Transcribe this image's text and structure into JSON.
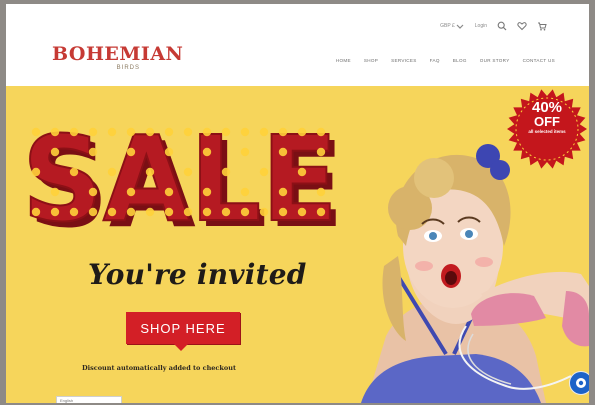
{
  "header": {
    "utility": {
      "currency": "GBP £",
      "login": "Login"
    },
    "logo": {
      "main": "BOHEMIAN",
      "sub": "BIRDS"
    },
    "nav": [
      "HOME",
      "SHOP",
      "SERVICES",
      "FAQ",
      "BLOG",
      "OUR STORY",
      "CONTACT US"
    ]
  },
  "hero": {
    "sale": "SALE",
    "invite": "You're invited",
    "cta": "SHOP HERE",
    "discount_note": "Discount automatically added to checkout",
    "badge": {
      "percent": "40%",
      "off": "OFF",
      "sub": "all selected items"
    }
  },
  "footer": {
    "language": "English"
  },
  "colors": {
    "hero_bg": "#f6d55b",
    "brand_red": "#c63a34",
    "cta_red": "#d31f26",
    "marquee_red": "#b51a22",
    "bulb": "#ffd23a",
    "chat_blue": "#1d63c8"
  },
  "icons": [
    "search-icon",
    "heart-icon",
    "cart-icon",
    "chat-icon",
    "chevron-down-icon"
  ]
}
